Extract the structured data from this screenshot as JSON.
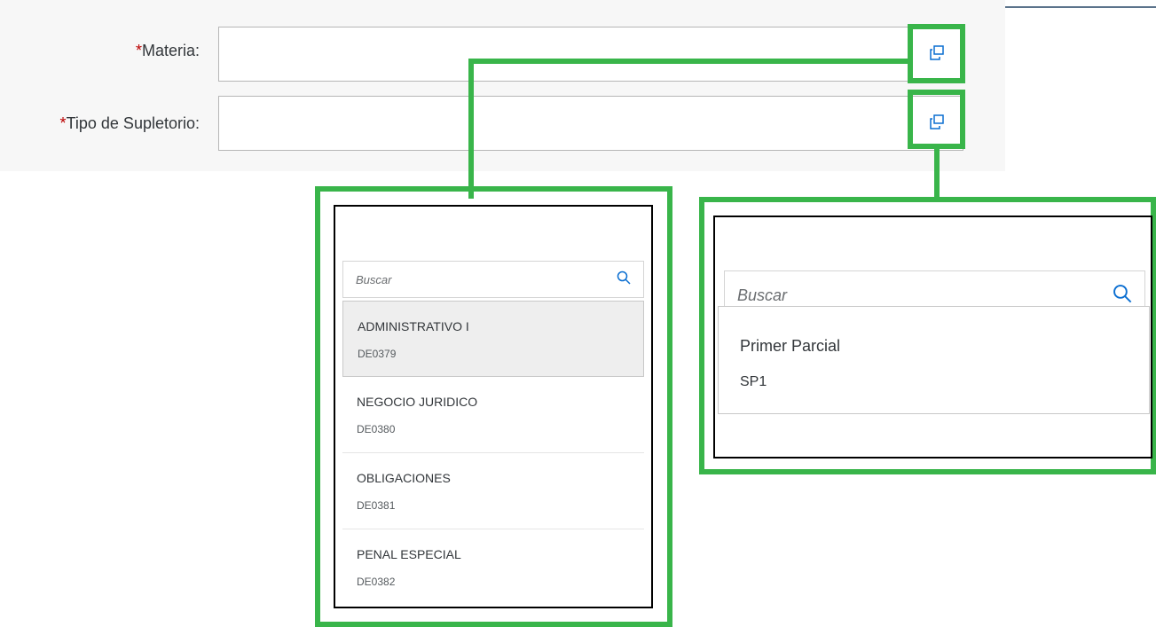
{
  "form": {
    "required_mark": "*",
    "materia_label": "Materia:",
    "tipo_label": "Tipo de Supletorio:",
    "materia_value": "",
    "tipo_value": ""
  },
  "icons": {
    "value_help": "value-help-icon",
    "search": "search-icon"
  },
  "colors": {
    "highlight": "#39b54a",
    "required": "#bb0000",
    "selected_row": "#eeeeee"
  },
  "materia_popup": {
    "search_placeholder": "Buscar",
    "items": [
      {
        "title": "ADMINISTRATIVO I",
        "code": "DE0379",
        "selected": true
      },
      {
        "title": "NEGOCIO JURIDICO",
        "code": "DE0380",
        "selected": false
      },
      {
        "title": "OBLIGACIONES",
        "code": "DE0381",
        "selected": false
      },
      {
        "title": "PENAL ESPECIAL",
        "code": "DE0382",
        "selected": false
      }
    ]
  },
  "tipo_popup": {
    "search_placeholder": "Buscar",
    "items": [
      {
        "title": "Primer Parcial",
        "code": "SP1",
        "selected": false
      }
    ]
  }
}
